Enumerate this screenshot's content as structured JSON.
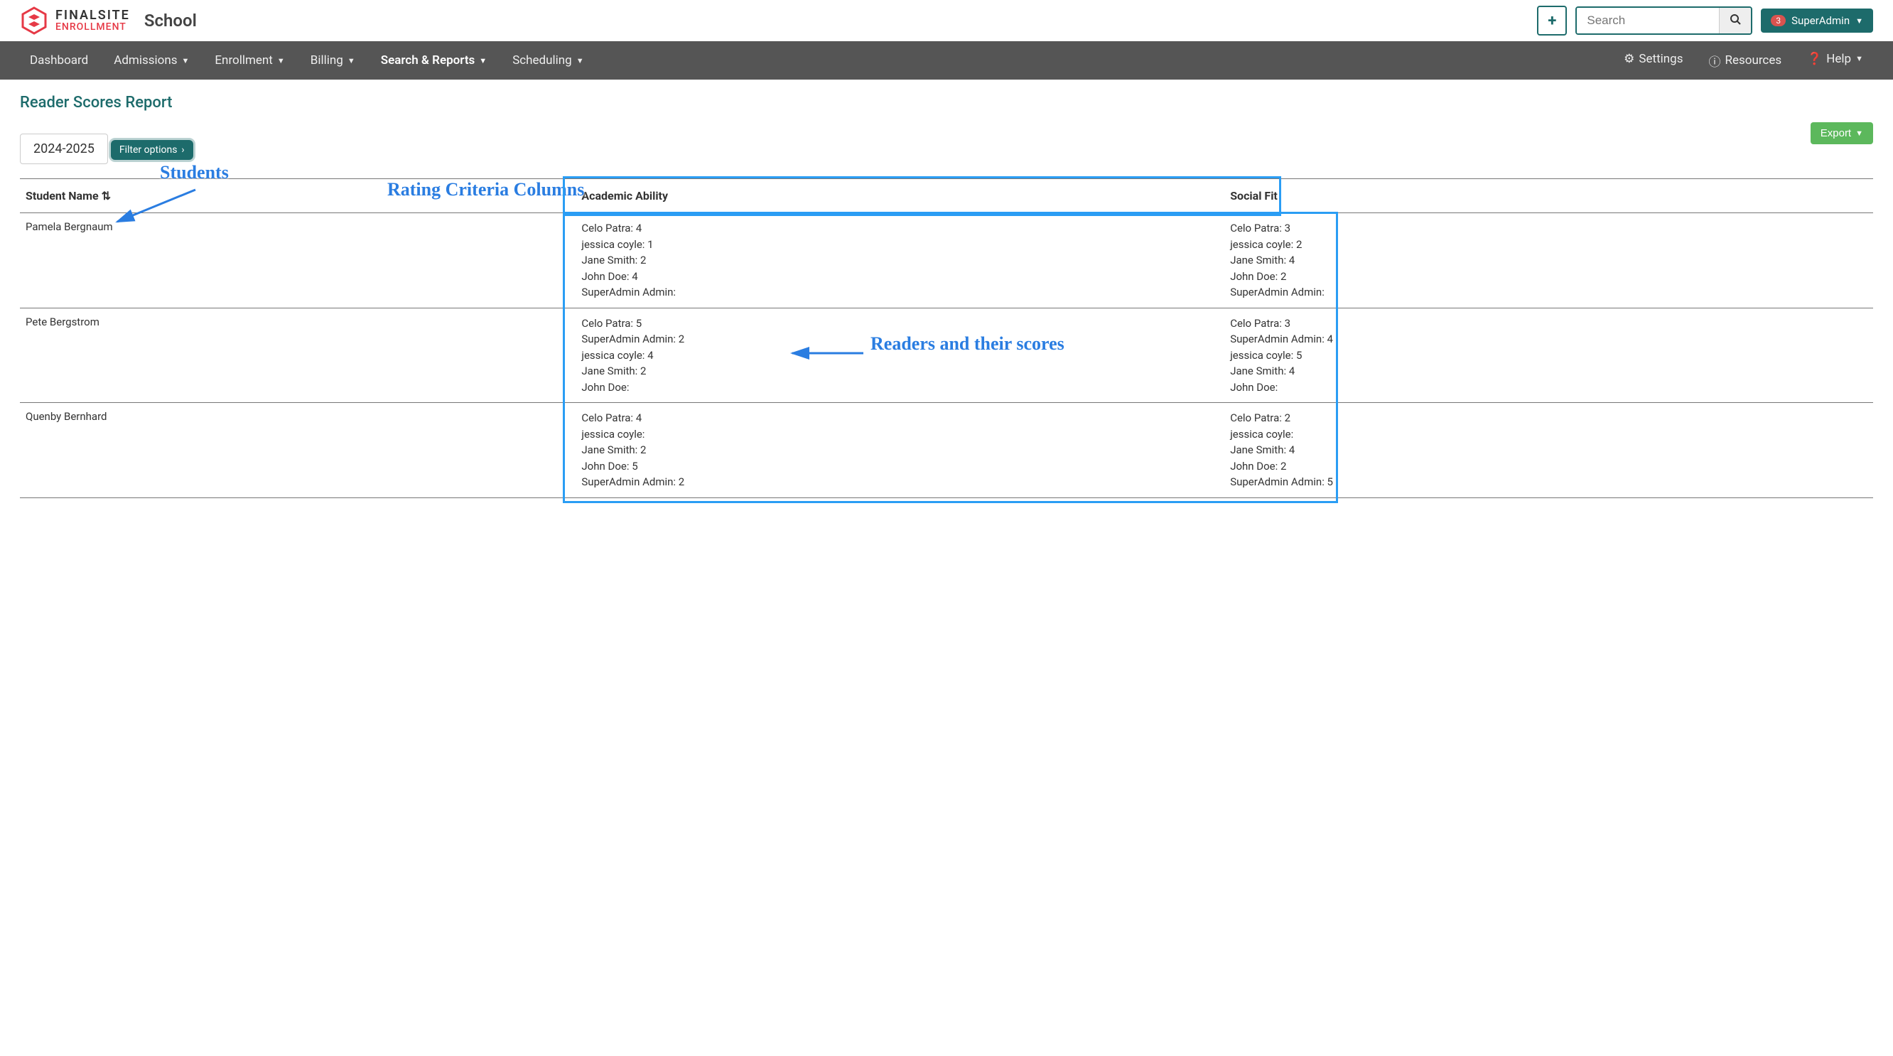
{
  "header": {
    "logo_line1": "FINALSITE",
    "logo_line2": "ENROLLMENT",
    "school_label": "School",
    "search_placeholder": "Search",
    "user_badge": "3",
    "user_name": "SuperAdmin"
  },
  "nav": {
    "items": [
      "Dashboard",
      "Admissions",
      "Enrollment",
      "Billing",
      "Search & Reports",
      "Scheduling"
    ],
    "right": [
      "Settings",
      "Resources",
      "Help"
    ]
  },
  "page": {
    "title": "Reader Scores Report",
    "year": "2024-2025",
    "export": "Export",
    "filter": "Filter options"
  },
  "annotations": {
    "students": "Students",
    "criteria": "Rating Criteria Columns",
    "readers": "Readers and their scores"
  },
  "table": {
    "headers": {
      "name": "Student Name",
      "crit1": "Academic Ability",
      "crit2": "Social Fit"
    },
    "rows": [
      {
        "name": "Pamela Bergnaum",
        "crit1": [
          "Celo Patra: 4",
          "jessica coyle: 1",
          "Jane Smith: 2",
          "John Doe: 4",
          "SuperAdmin Admin:"
        ],
        "crit2": [
          "Celo Patra: 3",
          "jessica coyle: 2",
          "Jane Smith: 4",
          "John Doe: 2",
          "SuperAdmin Admin:"
        ]
      },
      {
        "name": "Pete Bergstrom",
        "crit1": [
          "Celo Patra: 5",
          "SuperAdmin Admin: 2",
          "jessica coyle: 4",
          "Jane Smith: 2",
          "John Doe:"
        ],
        "crit2": [
          "Celo Patra: 3",
          "SuperAdmin Admin: 4",
          "jessica coyle: 5",
          "Jane Smith: 4",
          "John Doe:"
        ]
      },
      {
        "name": "Quenby Bernhard",
        "crit1": [
          "Celo Patra: 4",
          "jessica coyle:",
          "Jane Smith: 2",
          "John Doe: 5",
          "SuperAdmin Admin: 2"
        ],
        "crit2": [
          "Celo Patra: 2",
          "jessica coyle:",
          "Jane Smith: 4",
          "John Doe: 2",
          "SuperAdmin Admin: 5"
        ]
      }
    ]
  }
}
